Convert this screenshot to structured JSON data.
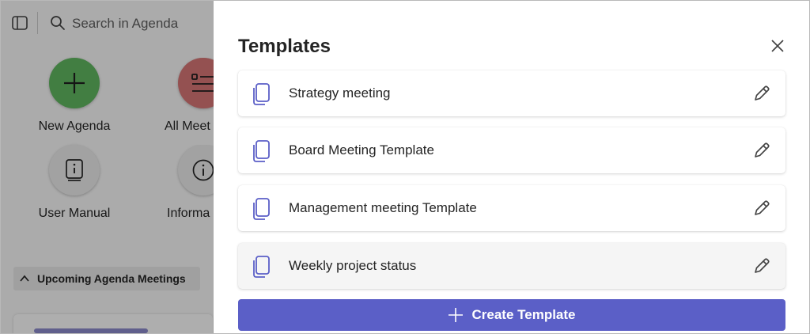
{
  "background": {
    "search_placeholder": "Search in Agenda",
    "tiles": [
      {
        "label": "New Agenda",
        "icon": "plus-icon",
        "color": "#5fb55f"
      },
      {
        "label": "All Meet",
        "icon": "list-icon",
        "color": "#d47474"
      },
      {
        "label": "User Manual",
        "icon": "manual-icon",
        "color": "#e8e8e8"
      },
      {
        "label": "Informa",
        "icon": "info-icon",
        "color": "#e8e8e8"
      }
    ],
    "section_title": "Upcoming Agenda Meetings"
  },
  "panel": {
    "title": "Templates",
    "templates": [
      {
        "name": "Strategy meeting"
      },
      {
        "name": "Board Meeting Template"
      },
      {
        "name": "Management meeting Template"
      },
      {
        "name": "Weekly project status"
      }
    ],
    "create_label": "Create Template"
  },
  "colors": {
    "accent": "#5b5fc7",
    "doc_icon": "#5b5fc7"
  }
}
